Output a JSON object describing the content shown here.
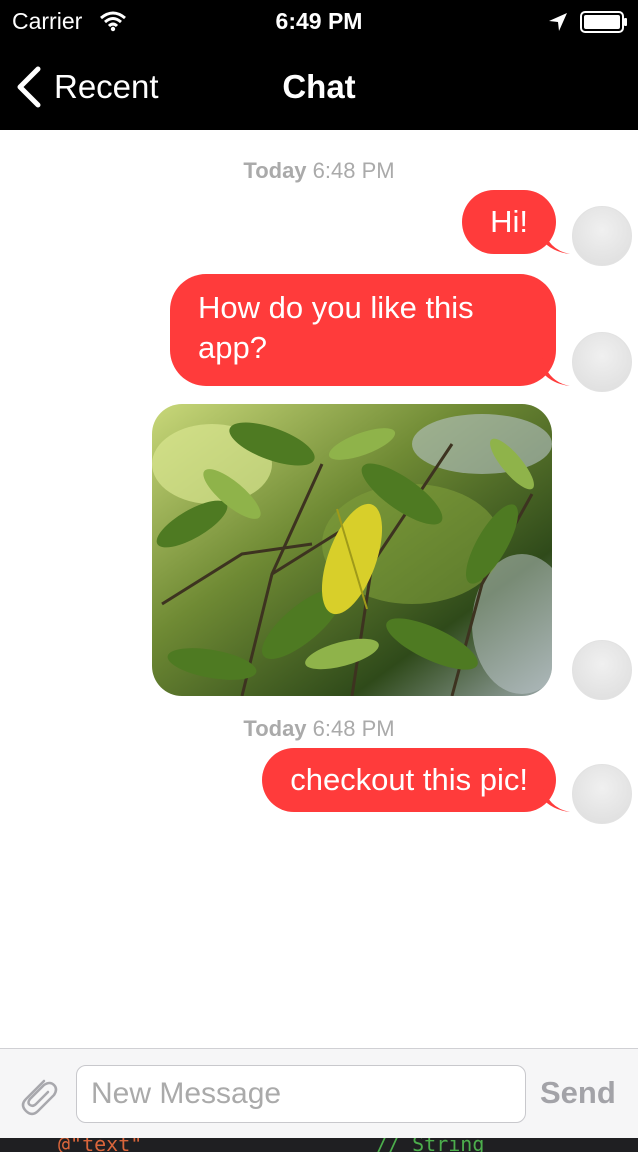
{
  "status_bar": {
    "carrier": "Carrier",
    "time": "6:49 PM"
  },
  "nav": {
    "back_label": "Recent",
    "title": "Chat"
  },
  "messages": {
    "timestamp_1": {
      "day": "Today",
      "time": "6:48 PM"
    },
    "bubble_1": "Hi!",
    "bubble_2": "How do you like this app?",
    "timestamp_2": {
      "day": "Today",
      "time": "6:48 PM"
    },
    "bubble_3": "checkout this pic!"
  },
  "input_bar": {
    "placeholder": "New Message",
    "value": "",
    "send_label": "Send"
  },
  "code_strip": {
    "left": "@\"text\"",
    "right": "//  String"
  },
  "colors": {
    "bubble": "#ff3b3b",
    "bar": "#000000",
    "send_disabled": "#a3a3a8"
  }
}
